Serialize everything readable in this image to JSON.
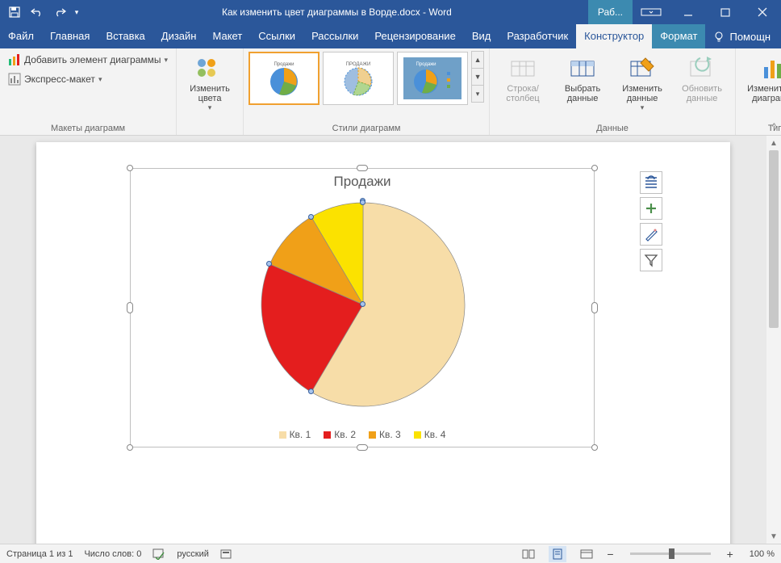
{
  "chart_data": {
    "type": "pie",
    "title": "Продажи",
    "series": [
      {
        "name": "Кв. 1",
        "value": 58.5,
        "color": "#F7DDA8"
      },
      {
        "name": "Кв. 2",
        "value": 23.0,
        "color": "#E41E1E"
      },
      {
        "name": "Кв. 3",
        "value": 10.0,
        "color": "#F0A018"
      },
      {
        "name": "Кв. 4",
        "value": 8.5,
        "color": "#FBE200"
      }
    ]
  },
  "titlebar": {
    "document_title": "Как изменить цвет диаграммы в Ворде.docx - Word",
    "contextual_title": "Раб..."
  },
  "tabs": {
    "items": [
      "Файл",
      "Главная",
      "Вставка",
      "Дизайн",
      "Макет",
      "Ссылки",
      "Рассылки",
      "Рецензирование",
      "Вид",
      "Разработчик",
      "Конструктор",
      "Формат"
    ],
    "active": "Конструктор",
    "contextual_from_index": 10,
    "help": "Помощн"
  },
  "ribbon": {
    "layouts": {
      "label": "Макеты диаграмм",
      "add_element": "Добавить элемент диаграммы",
      "express_layout": "Экспресс-макет"
    },
    "colors": {
      "label": "Изменить цвета"
    },
    "styles": {
      "label": "Стили диаграмм"
    },
    "data": {
      "label": "Данные",
      "row_col": "Строка/столбец",
      "select_data": "Выбрать данные",
      "edit_data": "Изменить данные",
      "refresh_data": "Обновить данные"
    },
    "type": {
      "label": "Тип",
      "change_type": "Изменить тип диаграммы"
    }
  },
  "legend": {
    "items": [
      "Кв. 1",
      "Кв. 2",
      "Кв. 3",
      "Кв. 4"
    ]
  },
  "status": {
    "page": "Страница 1 из 1",
    "words": "Число слов: 0",
    "lang": "русский",
    "zoom": "100 %"
  }
}
